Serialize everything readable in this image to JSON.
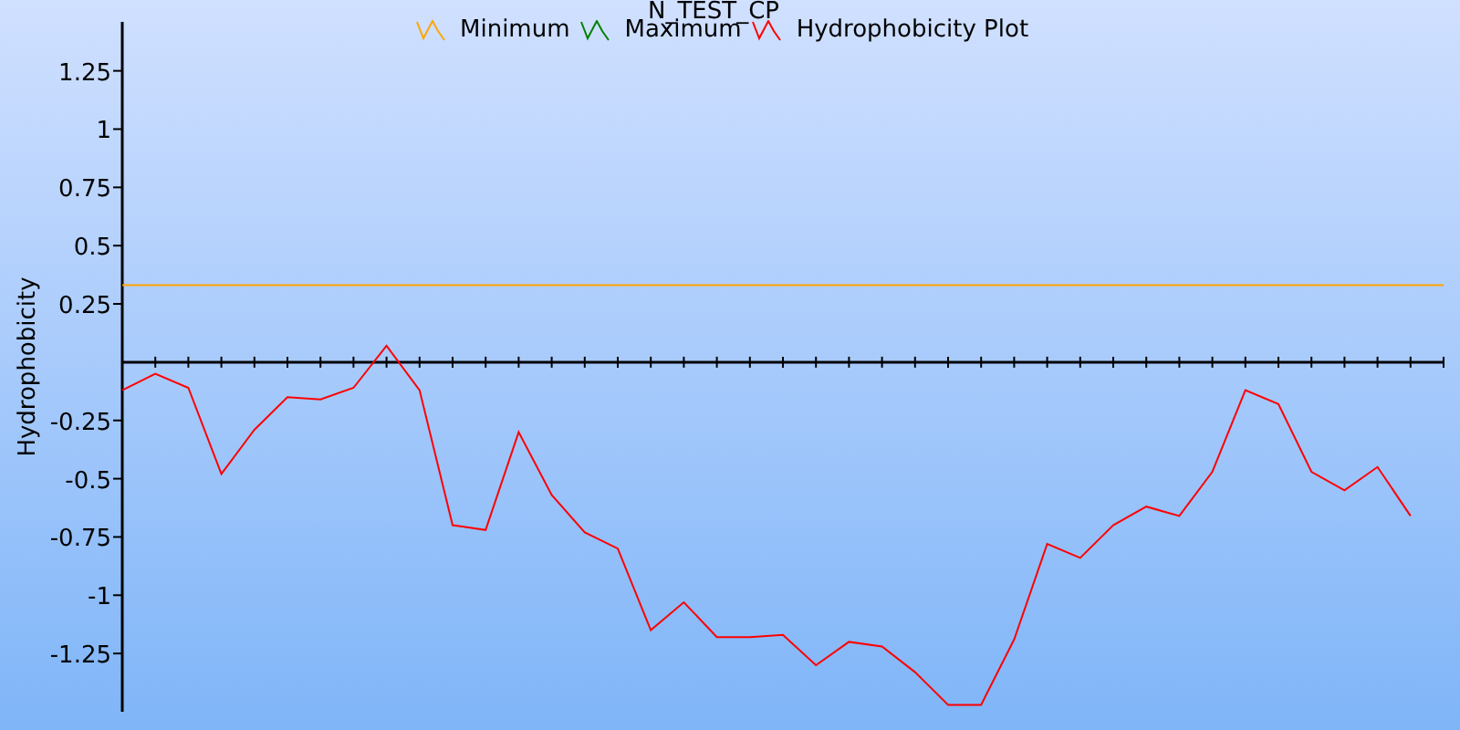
{
  "chart": {
    "chart_data": {
      "type": "line",
      "title": "N_TEST_CP",
      "ylabel": "Hydrophobicity",
      "legend": true,
      "ylim": [
        -1.5,
        1.46
      ],
      "yticks": [
        1.25,
        1,
        0.75,
        0.5,
        0.25,
        -0.25,
        -0.5,
        -0.75,
        -1,
        -1.25
      ],
      "series": [
        {
          "name": "Minimum",
          "color": "#ffa500",
          "values": [
            0.33,
            0.33,
            0.33,
            0.33,
            0.33,
            0.33,
            0.33,
            0.33,
            0.33,
            0.33,
            0.33,
            0.33,
            0.33,
            0.33,
            0.33,
            0.33,
            0.33,
            0.33,
            0.33,
            0.33,
            0.33,
            0.33,
            0.33,
            0.33,
            0.33,
            0.33,
            0.33,
            0.33,
            0.33,
            0.33,
            0.33,
            0.33,
            0.33,
            0.33,
            0.33,
            0.33,
            0.33,
            0.33,
            0.33,
            0.33,
            0.33
          ]
        },
        {
          "name": "Maximum",
          "color": "#008000",
          "values": [
            null,
            null,
            null,
            null,
            null,
            null,
            null,
            null,
            null,
            null,
            null,
            null,
            null,
            null,
            null,
            null,
            null,
            null,
            null,
            null,
            null,
            null,
            null,
            null,
            null,
            null,
            null,
            null,
            null,
            null,
            null,
            null,
            null,
            null,
            null,
            null,
            null,
            null,
            null,
            null,
            null
          ]
        },
        {
          "name": "Hydrophobicity Plot",
          "color": "#ff0000",
          "values": [
            -0.12,
            -0.05,
            -0.11,
            -0.48,
            -0.29,
            -0.15,
            -0.16,
            -0.11,
            0.07,
            -0.12,
            -0.7,
            -0.72,
            -0.3,
            -0.57,
            -0.73,
            -0.8,
            -1.15,
            -1.03,
            -1.18,
            -1.18,
            -1.17,
            -1.3,
            -1.2,
            -1.22,
            -1.33,
            -1.47,
            -1.47,
            -1.19,
            -0.78,
            -0.84,
            -0.7,
            -0.62,
            -0.66,
            -0.47,
            -0.12,
            -0.18,
            -0.47,
            -0.55,
            -0.45,
            -0.66,
            null
          ]
        }
      ]
    }
  }
}
